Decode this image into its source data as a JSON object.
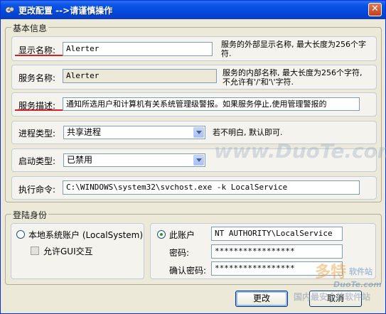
{
  "window": {
    "title": "更改配置 -->请谨慎操作",
    "close_glyph": "✕"
  },
  "basic_group": {
    "title": "基本信息",
    "display_name": {
      "label": "显示名称:",
      "value": "Alerter",
      "help": "服务的外部显示名称, 最大长度为256个字符."
    },
    "service_name": {
      "label": "服务名称:",
      "value": "Alerter",
      "help": "服务的内部名称, 最大长度为256个字符, 不允许有'/'和'\\'字符."
    },
    "description": {
      "label": "服务描述:",
      "value": "通知所选用户和计算机有关系统管理级警报。如果服务停止,使用管理警报的"
    },
    "process_type": {
      "label": "进程类型:",
      "value": "共享进程",
      "help": "若不明白, 默认即可."
    },
    "startup_type": {
      "label": "启动类型:",
      "value": "已禁用"
    },
    "command": {
      "label": "执行命令:",
      "value": "C:\\WINDOWS\\system32\\svchost.exe -k LocalService"
    }
  },
  "login_group": {
    "title": "登陆身份",
    "local_system": {
      "label": "本地系统账户 (LocalSystem)",
      "selected": false
    },
    "allow_gui": {
      "label": "允许GUI交互",
      "checked": false
    },
    "this_account": {
      "label": "此账户",
      "selected": true,
      "value": "NT AUTHORITY\\LocalService"
    },
    "password": {
      "label": "密码:",
      "value": "*****************"
    },
    "confirm_password": {
      "label": "确认密码:",
      "value": "*****************"
    }
  },
  "buttons": {
    "ok": "更改",
    "cancel": "取消"
  },
  "watermarks": {
    "site1": "www.DuoTe.com",
    "brand": "多特",
    "brand_sub": "软件站",
    "site2": "DuoTe.com",
    "banner": "国内最安全的软件站"
  },
  "colors": {
    "titlebar": "#0a54e6",
    "highlight_underline": "#d4202a",
    "window_bg": "#ECE9D8",
    "radio_dot": "#2a9a2a"
  }
}
